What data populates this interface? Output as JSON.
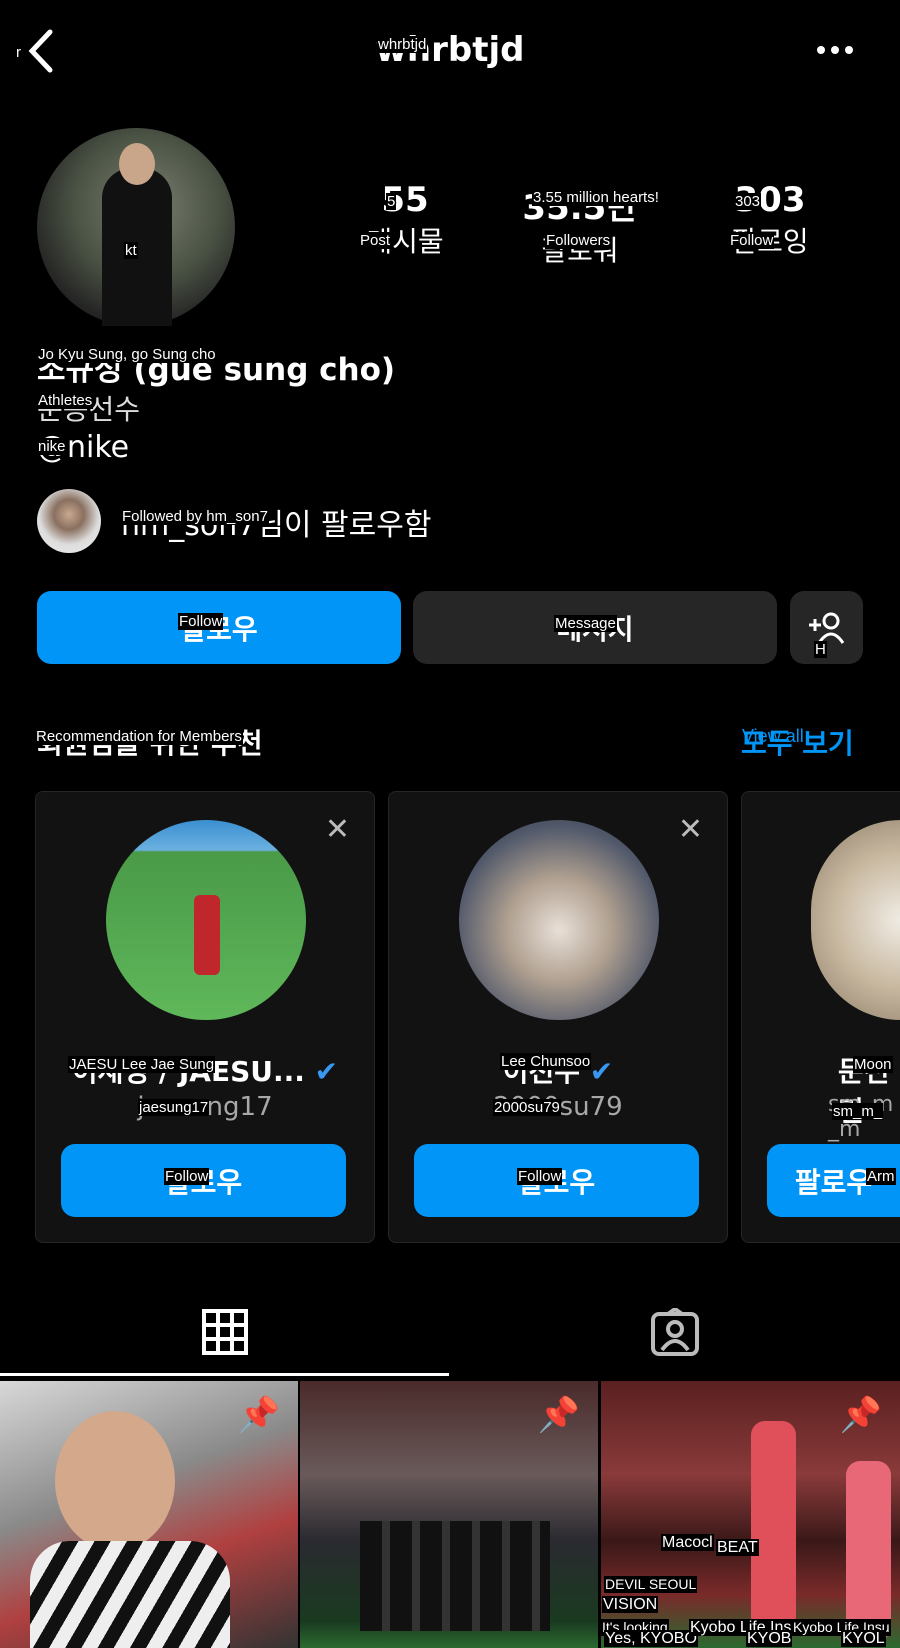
{
  "header": {
    "back_overlay": "r",
    "username": "whrbtjd",
    "username_overlay": "whrbtjd",
    "more_icon": "more-horizontal-icon"
  },
  "profile": {
    "avatar_overlay": "kt",
    "stats": [
      {
        "value": "55",
        "value_overlay": "5",
        "label": "게시물",
        "label_overlay": "Post"
      },
      {
        "value": "35.5만",
        "value_overlay": "3.55 million hearts!",
        "label": "팔로워",
        "label_overlay": "Followers"
      },
      {
        "value": "303",
        "value_overlay": "303",
        "label": "팔로잉",
        "label_overlay": "Follow"
      }
    ],
    "name": "조규성 (gue sung cho)",
    "name_overlay": "Jo Kyu Sung, go Sung cho",
    "category": "운동선수",
    "category_overlay": "Athletes",
    "link": "@nike",
    "link_overlay": "nike",
    "followed_by": "hm_son7님이 팔로우함",
    "followed_by_overlay": "Followed by hm_son7"
  },
  "actions": {
    "follow": "팔로우",
    "follow_overlay": "Follow",
    "message": "메시지",
    "message_overlay": "Message",
    "add_overlay": "H"
  },
  "suggestions": {
    "title": "회원님을 위한 추천",
    "title_overlay": "Recommendation for Members",
    "view_all": "모두 보기",
    "view_all_overlay": "View all",
    "cards": [
      {
        "name": "이재성 / JAESU...",
        "name_overlay": "JAESU Lee Jae Sung",
        "username": "jaesung17",
        "username_overlay": "jaesung17",
        "verified": true,
        "button": "팔로우",
        "button_overlay": "Follow"
      },
      {
        "name": "이천수",
        "name_overlay": "Lee Chunsoo",
        "username": "2000su79",
        "username_overlay": "2000su79",
        "verified": true,
        "button": "팔로우",
        "button_overlay": "Follow"
      },
      {
        "name": "문선민",
        "name_overlay": "Moon",
        "username": "sm_m_m",
        "username_overlay": "sm_m_",
        "verified": false,
        "button": "팔로우",
        "button_overlay": "Arm"
      }
    ]
  },
  "tabs": [
    {
      "icon": "grid-icon",
      "active": true
    },
    {
      "icon": "tagged-person-icon",
      "active": false
    }
  ],
  "posts_overlays": [
    "Macocl",
    "BEAT",
    "DEVIL SEOUL",
    "VISION",
    "It's looking",
    "Yes, KYOBO",
    "Kyobo Life Ins",
    "KYOB",
    "Kyobo Life Insu",
    "KYOL"
  ],
  "colors": {
    "accent": "#0095f6",
    "button_gray": "#262626",
    "card_bg": "#121212",
    "verified": "#3897f0"
  }
}
